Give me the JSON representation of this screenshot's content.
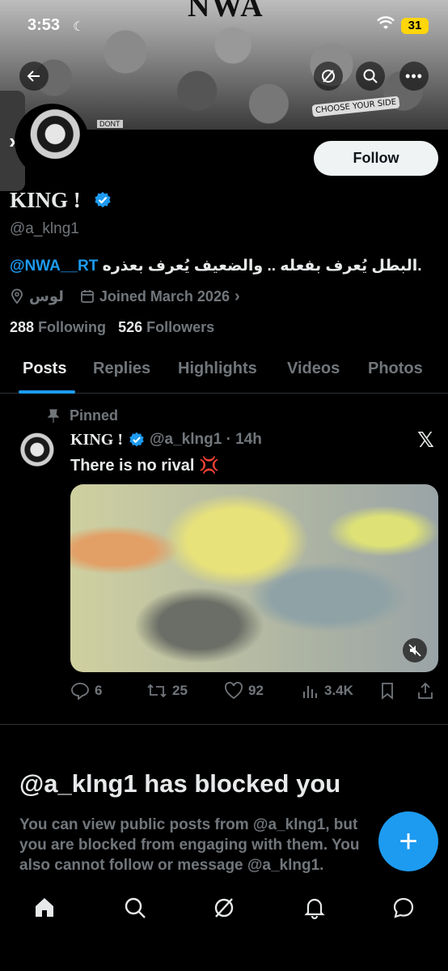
{
  "status_bar": {
    "time": "3:53",
    "battery": "31"
  },
  "banner": {
    "title": "NWA",
    "caption": "CHOOSE YOUR SIDE",
    "label": "DONT"
  },
  "profile": {
    "display_name": "KING !",
    "handle": "@a_klng1",
    "follow_label": "Follow",
    "bio_mention": "@NWA__RT",
    "bio_text": "البطل يُعرف بفعله .. والضعيف يُعرف بعذره.",
    "location": "لوس",
    "joined": "Joined March 2026",
    "following_count": "288",
    "following_label": "Following",
    "followers_count": "526",
    "followers_label": "Followers"
  },
  "tabs": [
    {
      "label": "Posts",
      "active": true
    },
    {
      "label": "Replies"
    },
    {
      "label": "Highlights"
    },
    {
      "label": "Videos"
    },
    {
      "label": "Photos"
    }
  ],
  "pinned_post": {
    "pinned_label": "Pinned",
    "author_name": "KING !",
    "handle_time": "@a_klng1 · 14h",
    "text": "There is no rival 💢",
    "replies": "6",
    "reposts": "25",
    "likes": "92",
    "views": "3.4K"
  },
  "blocked": {
    "title": "@a_klng1 has blocked you",
    "message": "You can view public posts from @a_klng1, but you are blocked from engaging with them. You also cannot follow or message @a_klng1."
  },
  "colors": {
    "accent": "#1d9bf0",
    "background": "#000000",
    "muted": "#71767b",
    "text": "#e7e9ea"
  },
  "icons": [
    "back-icon",
    "grok-icon",
    "search-icon",
    "more-icon",
    "location-icon",
    "calendar-icon",
    "pin-icon",
    "x-logo-icon",
    "mute-icon",
    "reply-icon",
    "repost-icon",
    "like-icon",
    "views-icon",
    "bookmark-icon",
    "share-icon",
    "home-icon",
    "explore-icon",
    "notifications-icon",
    "messages-icon",
    "plus-icon"
  ]
}
